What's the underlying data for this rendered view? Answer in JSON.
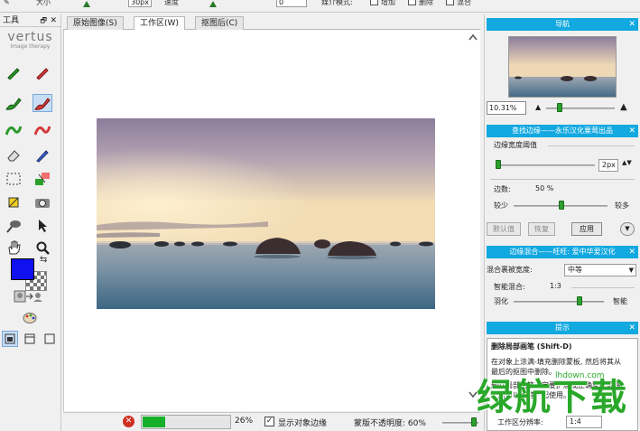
{
  "toolbar": {
    "size_label": "大小",
    "size_value": "30px",
    "speed_label": "速度",
    "speed_value": "0",
    "mode_label": "媒介模式:",
    "opt1": "增加",
    "opt2": "删除",
    "opt3": "混合"
  },
  "tools_panel": {
    "title": "工具",
    "pin": "🗗",
    "close": "✕",
    "logo_main": "vertus",
    "logo_sub": "image therapy"
  },
  "tabs": [
    {
      "label": "原始图像(S)"
    },
    {
      "label": "工作区(W)"
    },
    {
      "label": "抠图后(C)"
    }
  ],
  "status": {
    "progress_percent": 26,
    "progress_text": "26%",
    "show_edges_label": "显示对象边缘",
    "show_edges_checked": "✓",
    "opacity_text": "蒙版不透明度: 60%"
  },
  "right_panel": {
    "nav": {
      "title": "导航",
      "close": "✕",
      "zoom_value": "10.31%"
    },
    "edge": {
      "title": "查找边缘——永乐汉化粟莺出品",
      "close": "✕",
      "width_label": "边缘宽度阈值",
      "width_value": "2px",
      "edges_label": "边数:",
      "edges_value": "50 %",
      "less": "较少",
      "more": "较多",
      "default_btn": "默认值",
      "restore_btn": "恢复",
      "apply_btn": "应用"
    },
    "blend": {
      "title": "边缘混合——旺旺: 爱中华爱汉化",
      "close": "✕",
      "depth_label": "混合裹被宽度:",
      "depth_value": "中等",
      "smart_label": "智能混合:",
      "smart_value": "1:3",
      "feather": "羽化",
      "smart": "智能"
    },
    "tips": {
      "title": "提示",
      "close": "✕",
      "heading": "删除局部画笔 (Shift-D)",
      "body": "在对象上涂满-填充删除蒙板, 然后将其从最后的抠图中删除。",
      "body2": "删除局部画笔一定要扩展成正确蒙板区域一般可以画笔一起使用。"
    },
    "bottom": {
      "ratio_label": "工作区分辨率:",
      "ratio_value": "1:4"
    }
  },
  "watermark": {
    "main": "绿航下载",
    "site": "lhdown.com"
  },
  "colors": {
    "accent": "#12a8e0",
    "foreground_swatch": "#1010f0",
    "progress": "#17b02a"
  }
}
